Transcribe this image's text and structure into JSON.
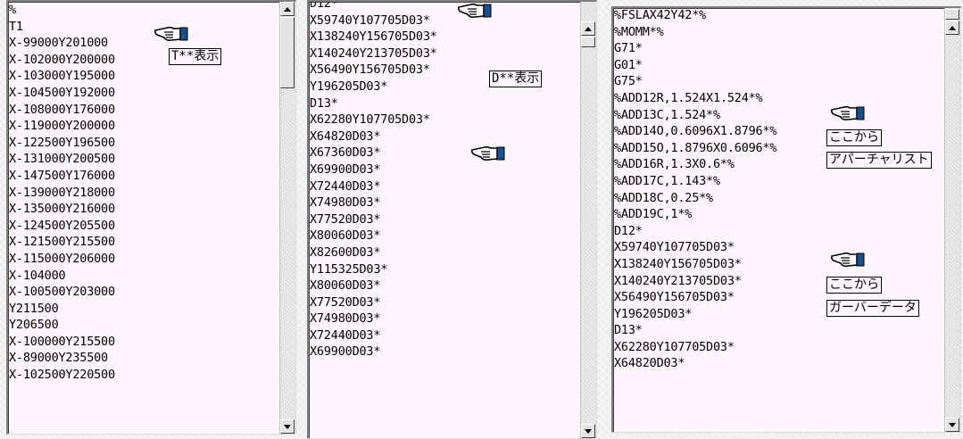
{
  "panel1": {
    "lines": [
      "%",
      "T1",
      "X-99000Y201000",
      "X-102000Y200000",
      "X-103000Y195000",
      "X-104500Y192000",
      "X-108000Y176000",
      "X-119000Y200000",
      "X-122500Y196500",
      "X-131000Y200500",
      "X-147500Y176000",
      "X-139000Y218000",
      "X-135000Y216000",
      "X-124500Y205500",
      "X-121500Y215500",
      "X-115000Y206000",
      "X-104000",
      "X-100500Y203000",
      "Y211500",
      "Y206500",
      "X-100000Y215500",
      "X-89000Y235500",
      "X-102500Y220500"
    ],
    "callout": "T**表示"
  },
  "panel2": {
    "lines": [
      "D12*",
      "X59740Y107705D03*",
      "X138240Y156705D03*",
      "X140240Y213705D03*",
      "X56490Y156705D03*",
      "Y196205D03*",
      "D13*",
      "X62280Y107705D03*",
      "X64820D03*",
      "X67360D03*",
      "X69900D03*",
      "X72440D03*",
      "X74980D03*",
      "X77520D03*",
      "X80060D03*",
      "X82600D03*",
      "Y115325D03*",
      "X80060D03*",
      "X77520D03*",
      "X74980D03*",
      "X72440D03*",
      "X69900D03*"
    ],
    "callout": "D**表示"
  },
  "panel3": {
    "lines": [
      "%FSLAX42Y42*%",
      "%MOMM*%",
      "G71*",
      "G01*",
      "G75*",
      "%ADD12R,1.524X1.524*%",
      "%ADD13C,1.524*%",
      "%ADD14O,0.6096X1.8796*%",
      "%ADD15O,1.8796X0.6096*%",
      "%ADD16R,1.3X0.6*%",
      "%ADD17C,1.143*%",
      "%ADD18C,0.25*%",
      "%ADD19C,1*%",
      "D12*",
      "X59740Y107705D03*",
      "X138240Y156705D03*",
      "X140240Y213705D03*",
      "X56490Y156705D03*",
      "Y196205D03*",
      "D13*",
      "X62280Y107705D03*",
      "X64820D03*"
    ],
    "callout1_line1": "ここから",
    "callout1_line2": "アパーチャリスト",
    "callout2_line1": "ここから",
    "callout2_line2": "ガーバーデータ"
  }
}
